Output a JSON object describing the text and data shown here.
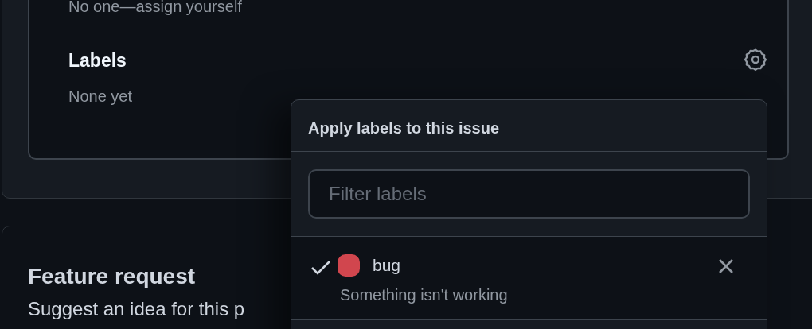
{
  "assignees": {
    "hint": "No one—assign yourself"
  },
  "labels_section": {
    "title": "Labels",
    "value": "None yet"
  },
  "template": {
    "title": "Feature request",
    "description": "Suggest an idea for this p"
  },
  "label_menu": {
    "title": "Apply labels to this issue",
    "filter": {
      "placeholder": "Filter labels"
    },
    "items": [
      {
        "name": "bug",
        "description": "Something isn't working",
        "color": "#d1464e",
        "checked": true
      }
    ]
  }
}
